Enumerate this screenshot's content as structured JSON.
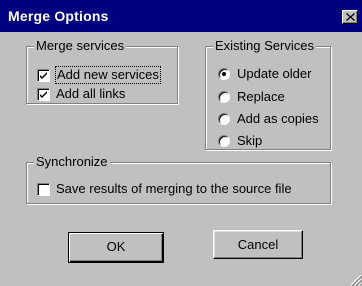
{
  "window": {
    "title": "Merge Options",
    "close_glyph": "✕"
  },
  "merge_services": {
    "legend": "Merge services",
    "options": [
      {
        "label": "Add new services",
        "checked": true
      },
      {
        "label": "Add all links",
        "checked": true
      }
    ]
  },
  "existing_services": {
    "legend": "Existing Services",
    "options": [
      {
        "label": "Update older",
        "selected": true
      },
      {
        "label": "Replace",
        "selected": false
      },
      {
        "label": "Add as copies",
        "selected": false
      },
      {
        "label": "Skip",
        "selected": false
      }
    ]
  },
  "synchronize": {
    "legend": "Synchronize",
    "option": {
      "label": "Save results of merging to the source file",
      "checked": false
    }
  },
  "buttons": {
    "ok": "OK",
    "cancel": "Cancel"
  },
  "colors": {
    "titlebar": "#000080",
    "face": "#c0c0c0"
  }
}
